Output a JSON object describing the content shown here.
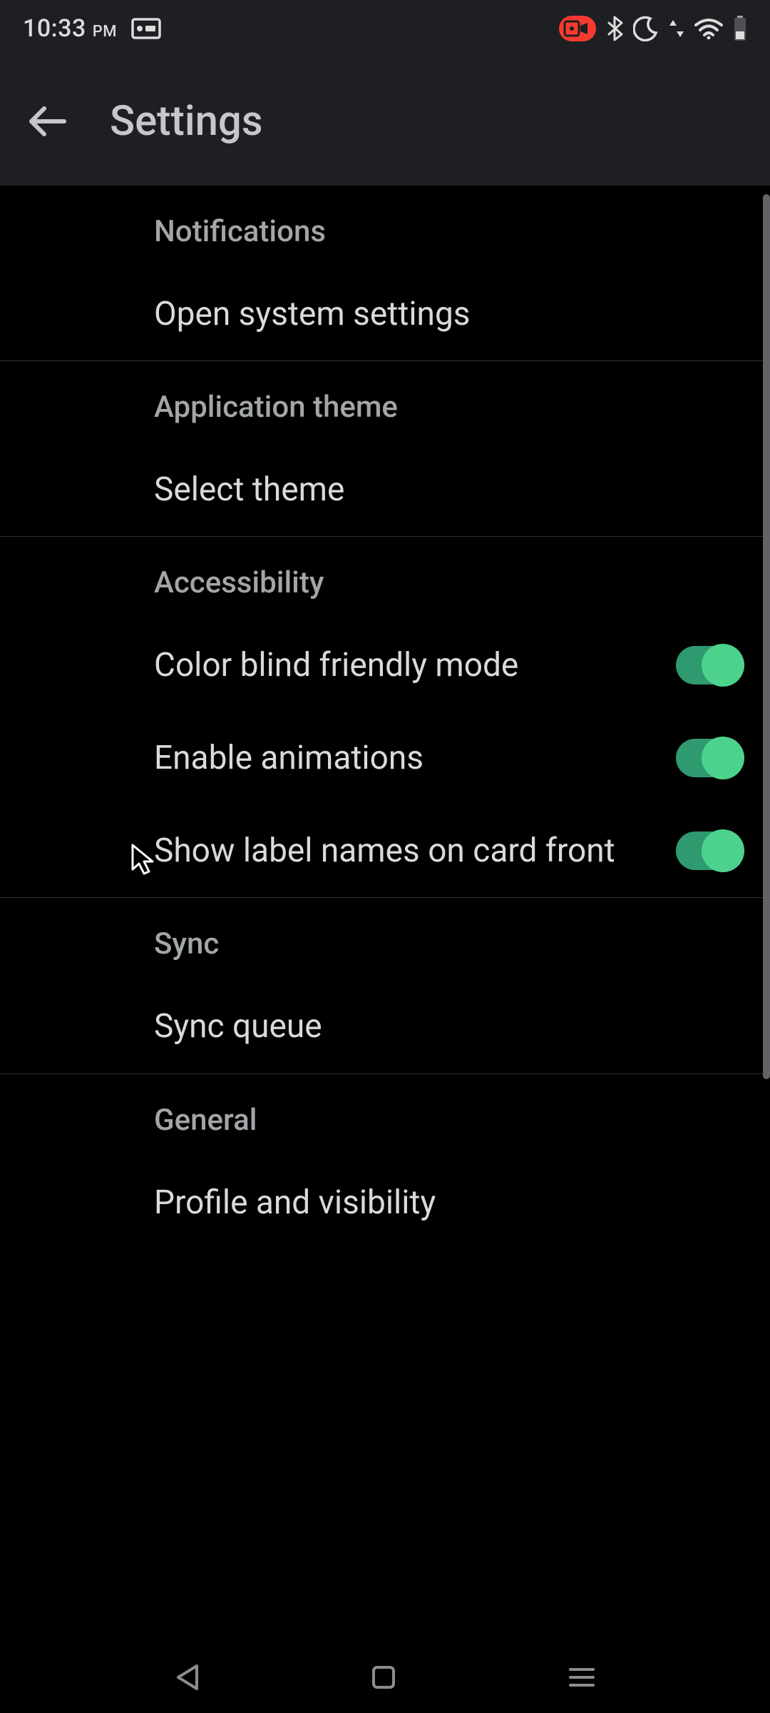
{
  "status": {
    "time": "10:33",
    "period": "PM"
  },
  "appbar": {
    "title": "Settings"
  },
  "sections": {
    "notifications": {
      "header": "Notifications",
      "open_system_settings": "Open system settings"
    },
    "theme": {
      "header": "Application theme",
      "select_theme": "Select theme"
    },
    "accessibility": {
      "header": "Accessibility",
      "color_blind": "Color blind friendly mode",
      "color_blind_on": true,
      "animations": "Enable animations",
      "animations_on": true,
      "label_names": "Show label names on card front",
      "label_names_on": true
    },
    "sync": {
      "header": "Sync",
      "sync_queue": "Sync queue"
    },
    "general": {
      "header": "General",
      "profile_visibility": "Profile and visibility"
    }
  }
}
